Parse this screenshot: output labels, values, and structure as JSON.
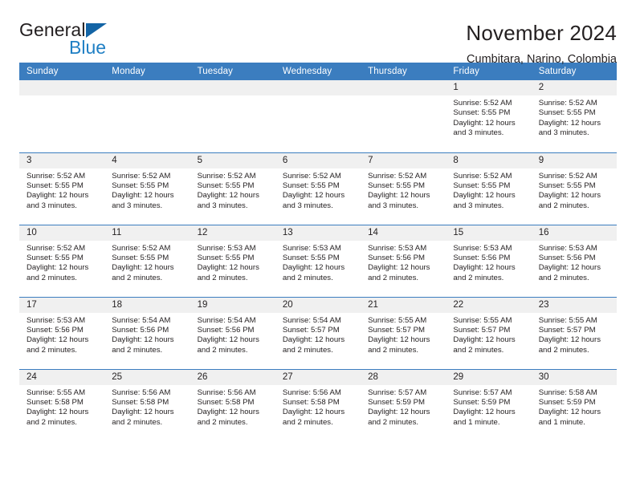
{
  "brand": {
    "name_part1": "General",
    "name_part2": "Blue",
    "flag_icon": "triangle-flag-icon",
    "accent_color": "#1364a5",
    "blue_text_color": "#1f7fc4"
  },
  "header": {
    "title": "November 2024",
    "subtitle": "Cumbitara, Narino, Colombia"
  },
  "calendar": {
    "header_bg": "#3b7dbf",
    "daynum_bg": "#f0f0f0",
    "weekday_headers": [
      "Sunday",
      "Monday",
      "Tuesday",
      "Wednesday",
      "Thursday",
      "Friday",
      "Saturday"
    ],
    "weeks": [
      [
        {
          "day": "",
          "sunrise": "",
          "sunset": "",
          "daylight1": "",
          "daylight2": ""
        },
        {
          "day": "",
          "sunrise": "",
          "sunset": "",
          "daylight1": "",
          "daylight2": ""
        },
        {
          "day": "",
          "sunrise": "",
          "sunset": "",
          "daylight1": "",
          "daylight2": ""
        },
        {
          "day": "",
          "sunrise": "",
          "sunset": "",
          "daylight1": "",
          "daylight2": ""
        },
        {
          "day": "",
          "sunrise": "",
          "sunset": "",
          "daylight1": "",
          "daylight2": ""
        },
        {
          "day": "1",
          "sunrise": "Sunrise: 5:52 AM",
          "sunset": "Sunset: 5:55 PM",
          "daylight1": "Daylight: 12 hours",
          "daylight2": "and 3 minutes."
        },
        {
          "day": "2",
          "sunrise": "Sunrise: 5:52 AM",
          "sunset": "Sunset: 5:55 PM",
          "daylight1": "Daylight: 12 hours",
          "daylight2": "and 3 minutes."
        }
      ],
      [
        {
          "day": "3",
          "sunrise": "Sunrise: 5:52 AM",
          "sunset": "Sunset: 5:55 PM",
          "daylight1": "Daylight: 12 hours",
          "daylight2": "and 3 minutes."
        },
        {
          "day": "4",
          "sunrise": "Sunrise: 5:52 AM",
          "sunset": "Sunset: 5:55 PM",
          "daylight1": "Daylight: 12 hours",
          "daylight2": "and 3 minutes."
        },
        {
          "day": "5",
          "sunrise": "Sunrise: 5:52 AM",
          "sunset": "Sunset: 5:55 PM",
          "daylight1": "Daylight: 12 hours",
          "daylight2": "and 3 minutes."
        },
        {
          "day": "6",
          "sunrise": "Sunrise: 5:52 AM",
          "sunset": "Sunset: 5:55 PM",
          "daylight1": "Daylight: 12 hours",
          "daylight2": "and 3 minutes."
        },
        {
          "day": "7",
          "sunrise": "Sunrise: 5:52 AM",
          "sunset": "Sunset: 5:55 PM",
          "daylight1": "Daylight: 12 hours",
          "daylight2": "and 3 minutes."
        },
        {
          "day": "8",
          "sunrise": "Sunrise: 5:52 AM",
          "sunset": "Sunset: 5:55 PM",
          "daylight1": "Daylight: 12 hours",
          "daylight2": "and 3 minutes."
        },
        {
          "day": "9",
          "sunrise": "Sunrise: 5:52 AM",
          "sunset": "Sunset: 5:55 PM",
          "daylight1": "Daylight: 12 hours",
          "daylight2": "and 2 minutes."
        }
      ],
      [
        {
          "day": "10",
          "sunrise": "Sunrise: 5:52 AM",
          "sunset": "Sunset: 5:55 PM",
          "daylight1": "Daylight: 12 hours",
          "daylight2": "and 2 minutes."
        },
        {
          "day": "11",
          "sunrise": "Sunrise: 5:52 AM",
          "sunset": "Sunset: 5:55 PM",
          "daylight1": "Daylight: 12 hours",
          "daylight2": "and 2 minutes."
        },
        {
          "day": "12",
          "sunrise": "Sunrise: 5:53 AM",
          "sunset": "Sunset: 5:55 PM",
          "daylight1": "Daylight: 12 hours",
          "daylight2": "and 2 minutes."
        },
        {
          "day": "13",
          "sunrise": "Sunrise: 5:53 AM",
          "sunset": "Sunset: 5:55 PM",
          "daylight1": "Daylight: 12 hours",
          "daylight2": "and 2 minutes."
        },
        {
          "day": "14",
          "sunrise": "Sunrise: 5:53 AM",
          "sunset": "Sunset: 5:56 PM",
          "daylight1": "Daylight: 12 hours",
          "daylight2": "and 2 minutes."
        },
        {
          "day": "15",
          "sunrise": "Sunrise: 5:53 AM",
          "sunset": "Sunset: 5:56 PM",
          "daylight1": "Daylight: 12 hours",
          "daylight2": "and 2 minutes."
        },
        {
          "day": "16",
          "sunrise": "Sunrise: 5:53 AM",
          "sunset": "Sunset: 5:56 PM",
          "daylight1": "Daylight: 12 hours",
          "daylight2": "and 2 minutes."
        }
      ],
      [
        {
          "day": "17",
          "sunrise": "Sunrise: 5:53 AM",
          "sunset": "Sunset: 5:56 PM",
          "daylight1": "Daylight: 12 hours",
          "daylight2": "and 2 minutes."
        },
        {
          "day": "18",
          "sunrise": "Sunrise: 5:54 AM",
          "sunset": "Sunset: 5:56 PM",
          "daylight1": "Daylight: 12 hours",
          "daylight2": "and 2 minutes."
        },
        {
          "day": "19",
          "sunrise": "Sunrise: 5:54 AM",
          "sunset": "Sunset: 5:56 PM",
          "daylight1": "Daylight: 12 hours",
          "daylight2": "and 2 minutes."
        },
        {
          "day": "20",
          "sunrise": "Sunrise: 5:54 AM",
          "sunset": "Sunset: 5:57 PM",
          "daylight1": "Daylight: 12 hours",
          "daylight2": "and 2 minutes."
        },
        {
          "day": "21",
          "sunrise": "Sunrise: 5:55 AM",
          "sunset": "Sunset: 5:57 PM",
          "daylight1": "Daylight: 12 hours",
          "daylight2": "and 2 minutes."
        },
        {
          "day": "22",
          "sunrise": "Sunrise: 5:55 AM",
          "sunset": "Sunset: 5:57 PM",
          "daylight1": "Daylight: 12 hours",
          "daylight2": "and 2 minutes."
        },
        {
          "day": "23",
          "sunrise": "Sunrise: 5:55 AM",
          "sunset": "Sunset: 5:57 PM",
          "daylight1": "Daylight: 12 hours",
          "daylight2": "and 2 minutes."
        }
      ],
      [
        {
          "day": "24",
          "sunrise": "Sunrise: 5:55 AM",
          "sunset": "Sunset: 5:58 PM",
          "daylight1": "Daylight: 12 hours",
          "daylight2": "and 2 minutes."
        },
        {
          "day": "25",
          "sunrise": "Sunrise: 5:56 AM",
          "sunset": "Sunset: 5:58 PM",
          "daylight1": "Daylight: 12 hours",
          "daylight2": "and 2 minutes."
        },
        {
          "day": "26",
          "sunrise": "Sunrise: 5:56 AM",
          "sunset": "Sunset: 5:58 PM",
          "daylight1": "Daylight: 12 hours",
          "daylight2": "and 2 minutes."
        },
        {
          "day": "27",
          "sunrise": "Sunrise: 5:56 AM",
          "sunset": "Sunset: 5:58 PM",
          "daylight1": "Daylight: 12 hours",
          "daylight2": "and 2 minutes."
        },
        {
          "day": "28",
          "sunrise": "Sunrise: 5:57 AM",
          "sunset": "Sunset: 5:59 PM",
          "daylight1": "Daylight: 12 hours",
          "daylight2": "and 2 minutes."
        },
        {
          "day": "29",
          "sunrise": "Sunrise: 5:57 AM",
          "sunset": "Sunset: 5:59 PM",
          "daylight1": "Daylight: 12 hours",
          "daylight2": "and 1 minute."
        },
        {
          "day": "30",
          "sunrise": "Sunrise: 5:58 AM",
          "sunset": "Sunset: 5:59 PM",
          "daylight1": "Daylight: 12 hours",
          "daylight2": "and 1 minute."
        }
      ]
    ]
  }
}
